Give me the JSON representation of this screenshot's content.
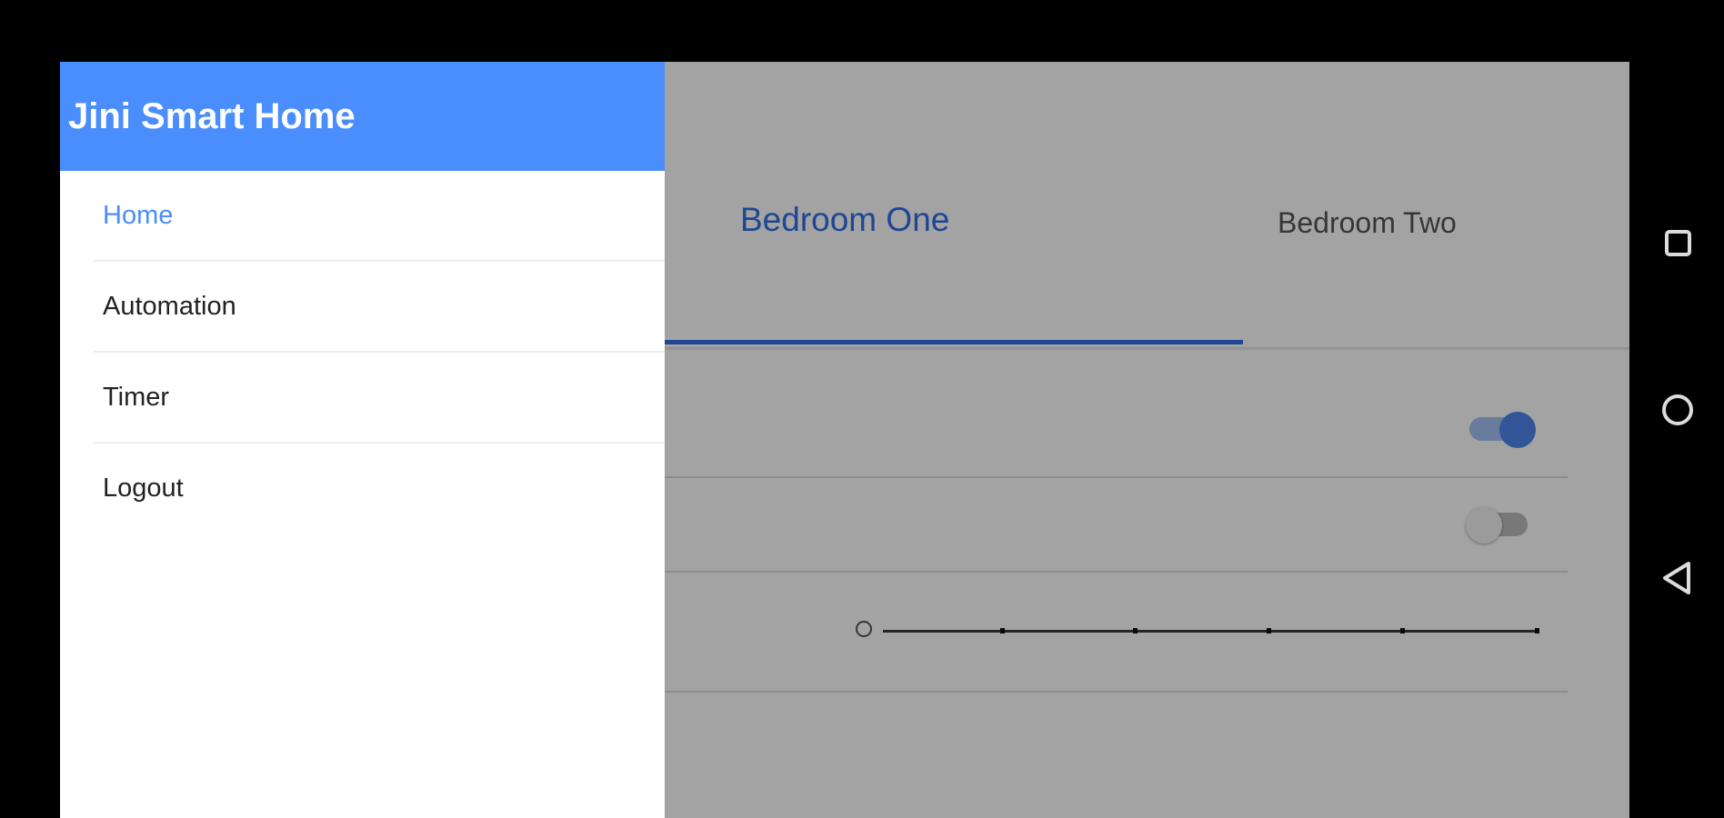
{
  "app": {
    "title": "Jini Smart Home"
  },
  "drawer": {
    "items": [
      {
        "label": "Home",
        "selected": true
      },
      {
        "label": "Automation",
        "selected": false
      },
      {
        "label": "Timer",
        "selected": false
      },
      {
        "label": "Logout",
        "selected": false
      }
    ]
  },
  "tabs": [
    {
      "label": "Bedroom One",
      "selected": true
    },
    {
      "label": "Bedroom Two",
      "selected": false
    }
  ],
  "controls": {
    "toggle_one_on": true,
    "toggle_two_on": false,
    "slider_value_fraction": 0
  },
  "system_nav": {
    "icons": [
      "recents-icon",
      "home-icon",
      "back-icon"
    ]
  },
  "colors": {
    "accent": "#4a8dfc",
    "tab_accent": "#2f6ee8",
    "background": "#000000"
  }
}
